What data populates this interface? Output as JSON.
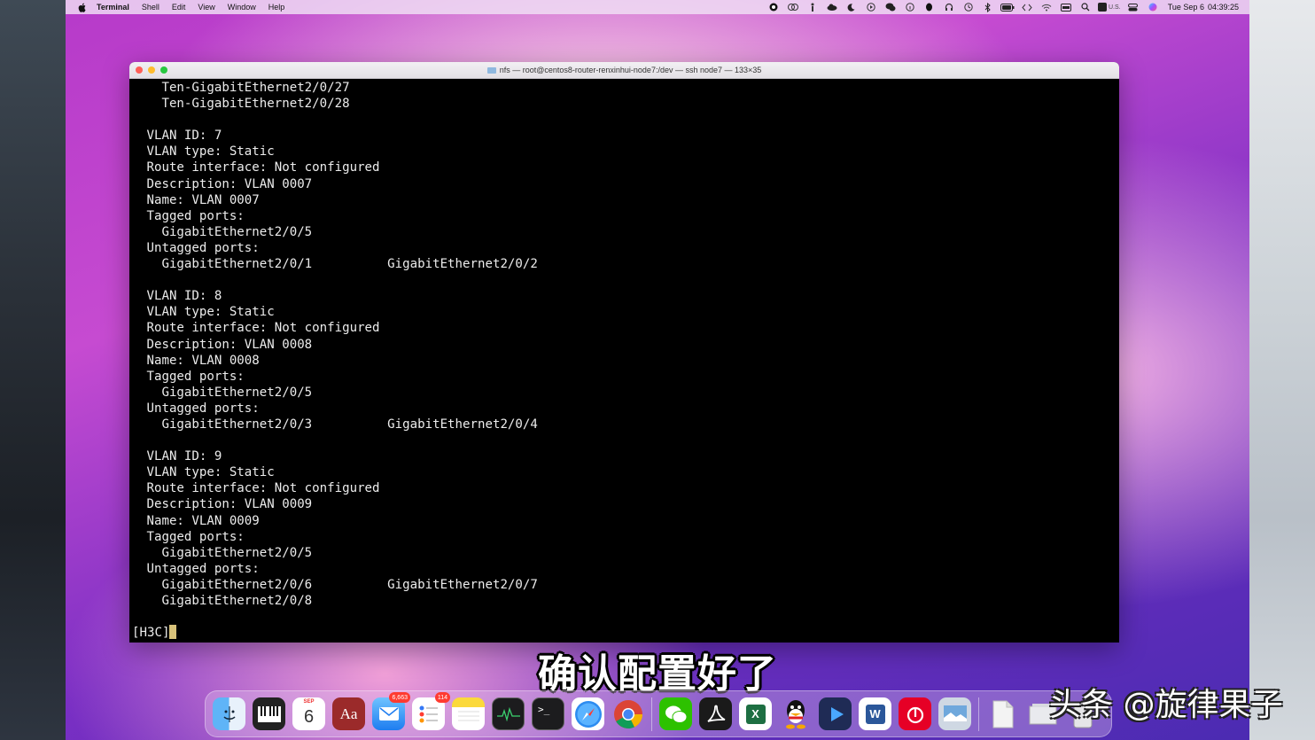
{
  "menubar": {
    "app_name": "Terminal",
    "items": [
      "Shell",
      "Edit",
      "View",
      "Window",
      "Help"
    ],
    "input_source": "U.S.",
    "date": "Tue Sep 6",
    "time": "04:39:25"
  },
  "window": {
    "title": "nfs — root@centos8-router-renxinhui-node7:/dev — ssh node7 — 133×35"
  },
  "terminal": {
    "lines": [
      [
        "   Ten-GigabitEthernet2/0/27",
        ""
      ],
      [
        "   Ten-GigabitEthernet2/0/28",
        ""
      ],
      [
        "",
        ""
      ],
      [
        " VLAN ID: 7",
        ""
      ],
      [
        " VLAN type: Static",
        ""
      ],
      [
        " Route interface: Not configured",
        ""
      ],
      [
        " Description: VLAN 0007",
        ""
      ],
      [
        " Name: VLAN 0007",
        ""
      ],
      [
        " Tagged ports:",
        ""
      ],
      [
        "   GigabitEthernet2/0/5",
        ""
      ],
      [
        " Untagged ports:",
        ""
      ],
      [
        "   GigabitEthernet2/0/1",
        "GigabitEthernet2/0/2"
      ],
      [
        "",
        ""
      ],
      [
        " VLAN ID: 8",
        ""
      ],
      [
        " VLAN type: Static",
        ""
      ],
      [
        " Route interface: Not configured",
        ""
      ],
      [
        " Description: VLAN 0008",
        ""
      ],
      [
        " Name: VLAN 0008",
        ""
      ],
      [
        " Tagged ports:",
        ""
      ],
      [
        "   GigabitEthernet2/0/5",
        ""
      ],
      [
        " Untagged ports:",
        ""
      ],
      [
        "   GigabitEthernet2/0/3",
        "GigabitEthernet2/0/4"
      ],
      [
        "",
        ""
      ],
      [
        " VLAN ID: 9",
        ""
      ],
      [
        " VLAN type: Static",
        ""
      ],
      [
        " Route interface: Not configured",
        ""
      ],
      [
        " Description: VLAN 0009",
        ""
      ],
      [
        " Name: VLAN 0009",
        ""
      ],
      [
        " Tagged ports:",
        ""
      ],
      [
        "   GigabitEthernet2/0/5",
        ""
      ],
      [
        " Untagged ports:",
        ""
      ],
      [
        "   GigabitEthernet2/0/6",
        "GigabitEthernet2/0/7"
      ],
      [
        "   GigabitEthernet2/0/8",
        ""
      ],
      [
        "",
        ""
      ]
    ],
    "prompt": "[H3C]"
  },
  "subtitle": "确认配置好了",
  "dock": {
    "calendar_month": "SEP",
    "calendar_day": "6",
    "dictionary_label": "Aa",
    "mail_badge": "6,663",
    "reminders_badge": "114",
    "terminal_glyph": ">_",
    "word_label": "W",
    "excel_label": "X"
  },
  "watermark": "头条 @旋律果子",
  "colors": {
    "terminal_bg": "#000000",
    "terminal_fg": "#ececec",
    "cursor": "#d8c27a",
    "close": "#fe5f57",
    "minimize": "#febc2e",
    "zoom": "#28c840"
  }
}
